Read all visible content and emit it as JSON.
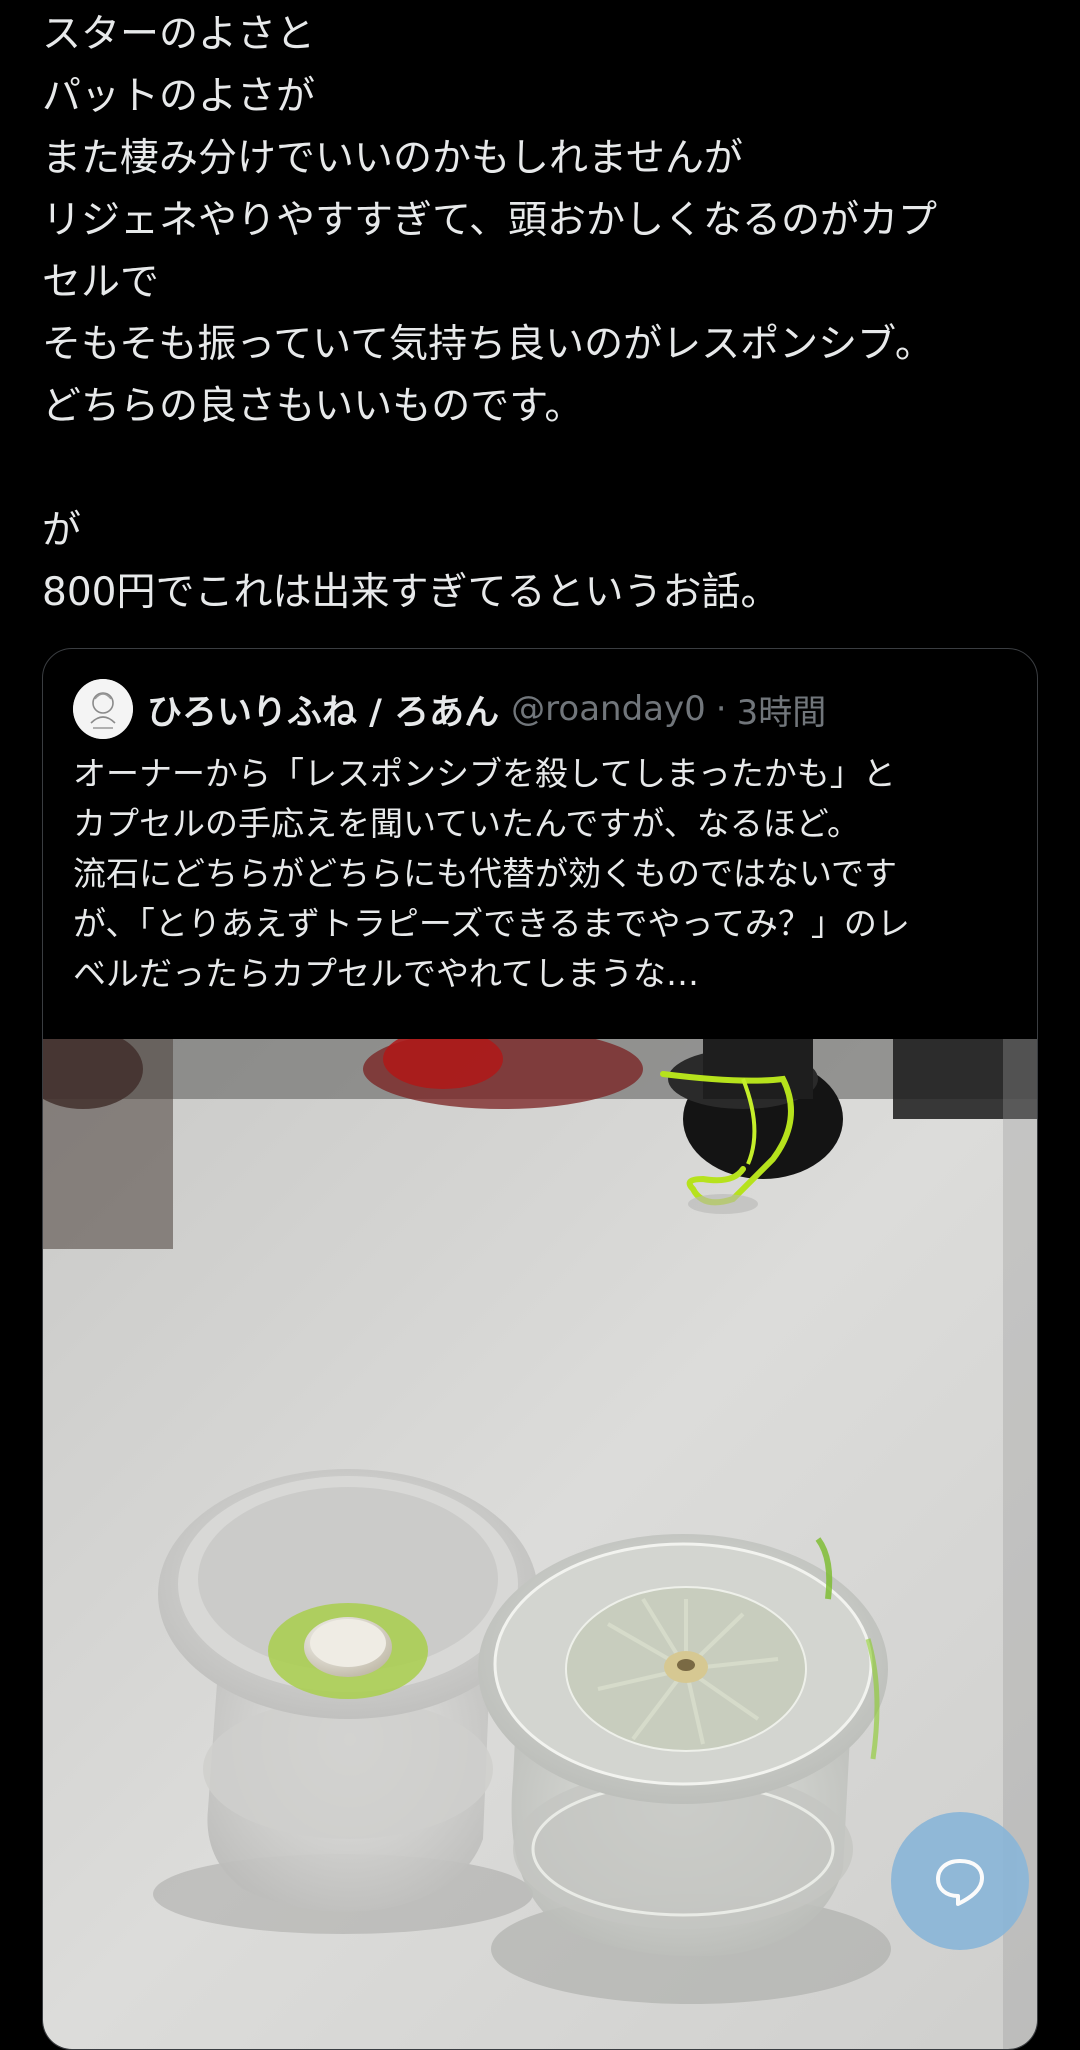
{
  "tweet": {
    "lines": [
      "スターのよさと",
      "パットのよさが",
      "また棲み分けでいいのかもしれませんが",
      "リジェネやりやすすぎて、頭おかしくなるのがカプ",
      "セルで",
      "そもそも振っていて気持ち良いのがレスポンシブ。",
      "どちらの良さもいいものです。",
      "",
      "が",
      "800円でこれは出来すぎてるというお話。"
    ]
  },
  "quote": {
    "display_name": "ひろいりふね / ろあん",
    "handle": "@roanday0",
    "separator": "·",
    "timestamp": "3時間",
    "lines": [
      "オーナーから「レスポンシブを殺してしまったかも」と",
      "カプセルの手応えを聞いていたんですが、なるほど。",
      "流石にどちらがどちらにも代替が効くものではないです",
      "が、「とりあえずトラピーズできるまでやってみ？」のレ",
      "ベルだったらカプセルでやれてしまうな…"
    ],
    "avatar_icon": "user-avatar-sketch",
    "image_subject": "yoyo-photo"
  },
  "fab": {
    "icon": "chat-bubble-icon",
    "color": "#8bb6d8"
  },
  "colors": {
    "background": "#000000",
    "text": "#e7e9ea",
    "muted": "#71767b",
    "border": "#3a3d41"
  }
}
